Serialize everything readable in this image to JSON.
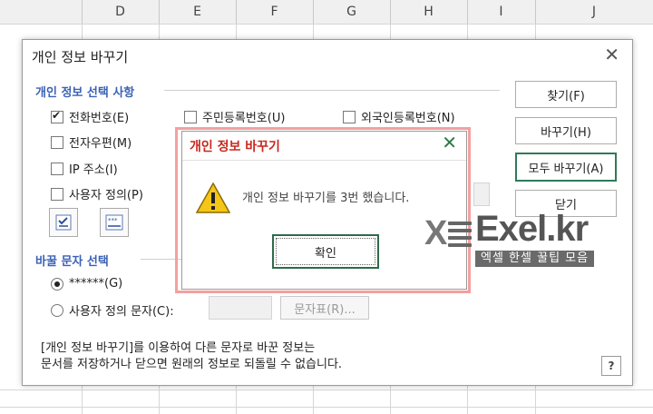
{
  "sheet": {
    "columns": [
      "D",
      "E",
      "F",
      "G",
      "H",
      "I",
      "J"
    ]
  },
  "dialog": {
    "title": "개인 정보 바꾸기",
    "close_glyph": "✕",
    "section1_title": "개인 정보 선택 사항",
    "checkboxes": [
      {
        "label": "전화번호(E)",
        "checked": true
      },
      {
        "label": "주민등록번호(U)",
        "checked": false
      },
      {
        "label": "외국인등록번호(N)",
        "checked": false
      },
      {
        "label": "전자우편(M)",
        "checked": false
      },
      {
        "label": "IP 주소(I)",
        "checked": false
      },
      {
        "label": "사용자 정의(P)",
        "checked": false
      }
    ],
    "section2_title": "바꿀 문자 선택",
    "radios": [
      {
        "label": "******(G)",
        "checked": true
      },
      {
        "label": "사용자 정의 문자(C):",
        "checked": false
      }
    ],
    "char_table_button": "문자표(R)...",
    "buttons": {
      "find": "찾기(F)",
      "replace": "바꾸기(H)",
      "replace_all": "모두 바꾸기(A)",
      "close": "닫기"
    },
    "note_line1": "[개인 정보 바꾸기]를 이용하여 다른 문자로 바꾼 정보는",
    "note_line2": "문서를 저장하거나 닫으면 원래의 정보로 되돌릴 수 없습니다.",
    "help": "?"
  },
  "message": {
    "title": "개인 정보 바꾸기",
    "close_glyph": "✕",
    "text": "개인 정보 바꾸기를 3번 했습니다.",
    "ok_label": "확인"
  },
  "watermark": {
    "brand": "Exel.kr",
    "tagline": "엑셀 한셀 꿀팁 모음"
  }
}
